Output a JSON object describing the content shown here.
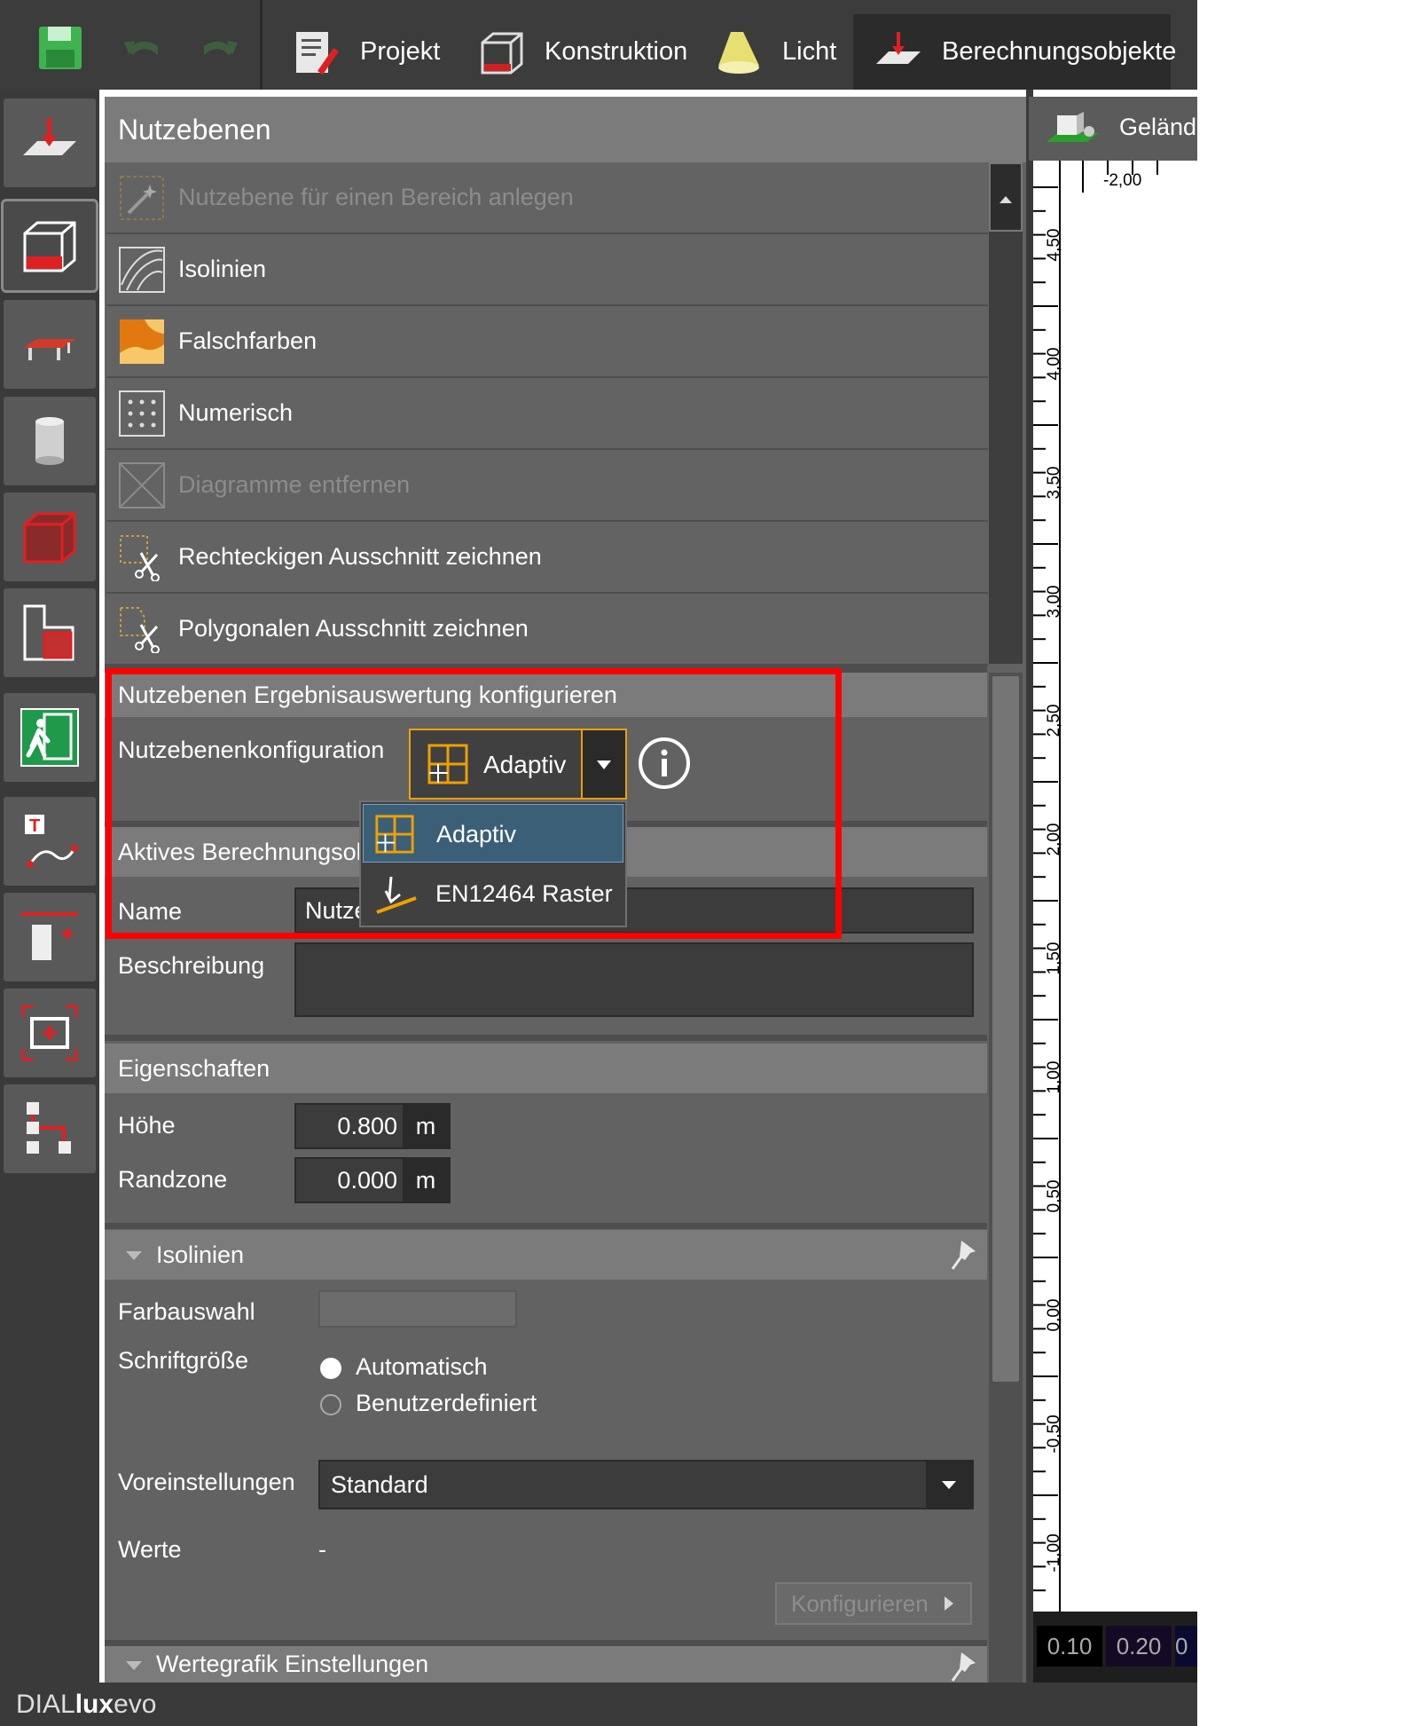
{
  "toolbar": {
    "tabs": [
      {
        "label": "Projekt"
      },
      {
        "label": "Konstruktion"
      },
      {
        "label": "Licht"
      },
      {
        "label": "Berechnungsobjekte"
      }
    ]
  },
  "panel": {
    "title": "Nutzebenen",
    "tools": [
      {
        "label": "Nutzebene für einen Bereich anlegen",
        "enabled": false,
        "icon": "magic-wand-icon"
      },
      {
        "label": "Isolinien",
        "enabled": true,
        "icon": "isolines-icon"
      },
      {
        "label": "Falschfarben",
        "enabled": true,
        "icon": "false-colors-icon"
      },
      {
        "label": "Numerisch",
        "enabled": true,
        "icon": "numeric-grid-icon"
      },
      {
        "label": "Diagramme entfernen",
        "enabled": false,
        "icon": "remove-diagrams-icon"
      },
      {
        "label": "Rechteckigen Ausschnitt zeichnen",
        "enabled": true,
        "icon": "rect-cut-icon"
      },
      {
        "label": "Polygonalen Ausschnitt zeichnen",
        "enabled": true,
        "icon": "polygon-cut-icon"
      }
    ],
    "config_section": {
      "title": "Nutzebenen Ergebnisauswertung konfigurieren",
      "label": "Nutzebenenkonfiguration",
      "selected": "Adaptiv",
      "options": [
        "Adaptiv",
        "EN12464 Raster"
      ]
    },
    "active_section": {
      "title": "Aktives Berechnungsobjekt",
      "title_visible": "Aktives Berechnungsob",
      "name_label": "Name",
      "name_value": "Nutze",
      "desc_label": "Beschreibung",
      "desc_value": ""
    },
    "properties": {
      "title": "Eigenschaften",
      "height_label": "Höhe",
      "height_value": "0.800",
      "height_unit": "m",
      "margin_label": "Randzone",
      "margin_value": "0.000",
      "margin_unit": "m"
    },
    "isolines": {
      "title": "Isolinien",
      "color_label": "Farbauswahl",
      "fontsize_label": "Schriftgröße",
      "radio_auto": "Automatisch",
      "radio_custom": "Benutzerdefiniert",
      "radio_selected": "Automatisch",
      "preset_label": "Voreinstellungen",
      "preset_value": "Standard",
      "values_label": "Werte",
      "values_value": "-",
      "configure_button": "Konfigurieren"
    },
    "value_graphic": {
      "title": "Wertegrafik Einstellungen"
    }
  },
  "right": {
    "tab": "Geländ",
    "ruler_top": "-2,00",
    "ruler_labels": [
      "4,50",
      "4,00",
      "3,50",
      "3,00",
      "2,50",
      "2,00",
      "1,50",
      "1,00",
      "0,50",
      "0,00",
      "-0,50",
      "-1,00"
    ],
    "legend_values": [
      "0.10",
      "0.20",
      "0"
    ]
  },
  "status": {
    "brand_pre": "DIAL",
    "brand_bold": "lux",
    "brand_post": "evo"
  },
  "colors": {
    "highlight": "#ff0000",
    "accent": "#f0a000",
    "selection": "#3c5f78"
  }
}
